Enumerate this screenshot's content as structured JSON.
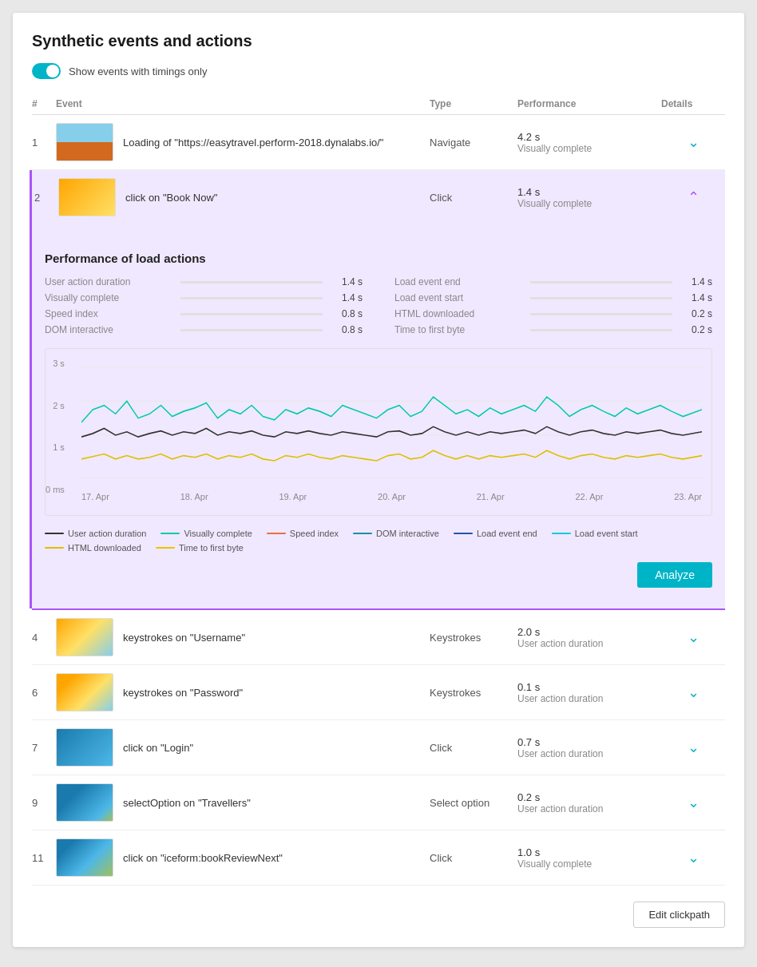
{
  "title": "Synthetic events and actions",
  "toggle": {
    "label": "Show events with timings only",
    "enabled": true
  },
  "table": {
    "headers": [
      "#",
      "Event",
      "Type",
      "Performance",
      "Details"
    ],
    "rows": [
      {
        "num": "1",
        "event": "Loading of \"https://easytravel.perform-2018.dynalabs.io/\"",
        "type": "Navigate",
        "perf_main": "4.2 s",
        "perf_sub": "Visually complete",
        "expanded": false,
        "thumb": "thumb-1"
      },
      {
        "num": "2",
        "event": "click on \"Book Now\"",
        "type": "Click",
        "perf_main": "1.4 s",
        "perf_sub": "Visually complete",
        "expanded": true,
        "thumb": "thumb-2"
      },
      {
        "num": "4",
        "event": "keystrokes on \"Username\"",
        "type": "Keystrokes",
        "perf_main": "2.0 s",
        "perf_sub": "User action duration",
        "expanded": false,
        "thumb": "thumb-4"
      },
      {
        "num": "6",
        "event": "keystrokes on \"Password\"",
        "type": "Keystrokes",
        "perf_main": "0.1 s",
        "perf_sub": "User action duration",
        "expanded": false,
        "thumb": "thumb-6"
      },
      {
        "num": "7",
        "event": "click on \"Login\"",
        "type": "Click",
        "perf_main": "0.7 s",
        "perf_sub": "User action duration",
        "expanded": false,
        "thumb": "thumb-7"
      },
      {
        "num": "9",
        "event": "selectOption on \"Travellers\"",
        "type": "Select option",
        "perf_main": "0.2 s",
        "perf_sub": "User action duration",
        "expanded": false,
        "thumb": "thumb-9"
      },
      {
        "num": "11",
        "event": "click on \"iceform:bookReviewNext\"",
        "type": "Click",
        "perf_main": "1.0 s",
        "perf_sub": "Visually complete",
        "expanded": false,
        "thumb": "thumb-11"
      }
    ]
  },
  "perf_section": {
    "title": "Performance of load actions",
    "left": [
      {
        "label": "User action duration",
        "value": "1.4 s"
      },
      {
        "label": "Visually complete",
        "value": "1.4 s"
      },
      {
        "label": "Speed index",
        "value": "0.8 s"
      },
      {
        "label": "DOM interactive",
        "value": "0.8 s"
      }
    ],
    "right": [
      {
        "label": "Load event end",
        "value": "1.4 s"
      },
      {
        "label": "Load event start",
        "value": "1.4 s"
      },
      {
        "label": "HTML downloaded",
        "value": "0.2 s"
      },
      {
        "label": "Time to first byte",
        "value": "0.2 s"
      }
    ]
  },
  "chart": {
    "y_labels": [
      "3 s",
      "2 s",
      "1 s",
      "0 ms"
    ],
    "x_labels": [
      "17. Apr",
      "18. Apr",
      "19. Apr",
      "20. Apr",
      "21. Apr",
      "22. Apr",
      "23. Apr"
    ],
    "legend": [
      {
        "label": "User action duration",
        "color": "#222"
      },
      {
        "label": "Visually complete",
        "color": "#00ccaa"
      },
      {
        "label": "Speed index",
        "color": "#e87040"
      },
      {
        "label": "DOM interactive",
        "color": "#1a8fa8"
      },
      {
        "label": "Load event end",
        "color": "#2255aa"
      },
      {
        "label": "Load event start",
        "color": "#00ccdd"
      },
      {
        "label": "HTML downloaded",
        "color": "#ddc000"
      },
      {
        "label": "Time to first byte",
        "color": "#f0c000"
      }
    ]
  },
  "analyze_button": "Analyze",
  "edit_button": "Edit clickpath"
}
